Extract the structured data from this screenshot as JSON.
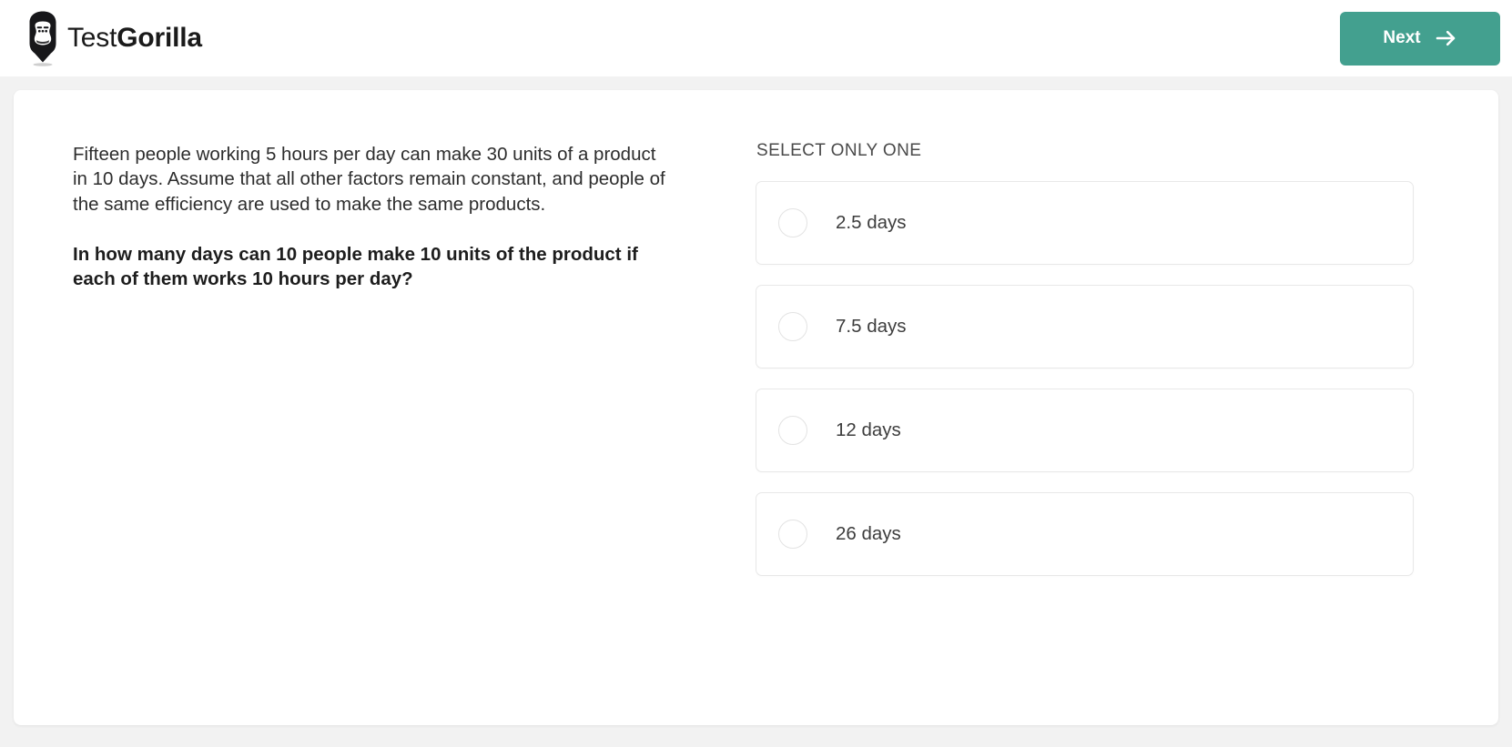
{
  "header": {
    "logo_icon": "gorilla-head-icon",
    "brand_part1": "Test",
    "brand_part2": "Gorilla",
    "next_label": "Next",
    "next_icon": "arrow-right-icon",
    "accent_color": "#43a08f"
  },
  "question": {
    "intro": "Fifteen people working 5 hours per day can make 30 units of a product in 10 days. Assume that all other factors remain constant, and people of the same efficiency are used to make the same products.",
    "prompt": "In how many days can 10 people make 10 units of the product if each of them works 10 hours per day?"
  },
  "answers": {
    "instruction": "SELECT ONLY ONE",
    "selected": null,
    "options": [
      {
        "label": "2.5 days",
        "selected": false
      },
      {
        "label": "7.5 days",
        "selected": false
      },
      {
        "label": "12 days",
        "selected": false
      },
      {
        "label": "26 days",
        "selected": false
      }
    ]
  }
}
